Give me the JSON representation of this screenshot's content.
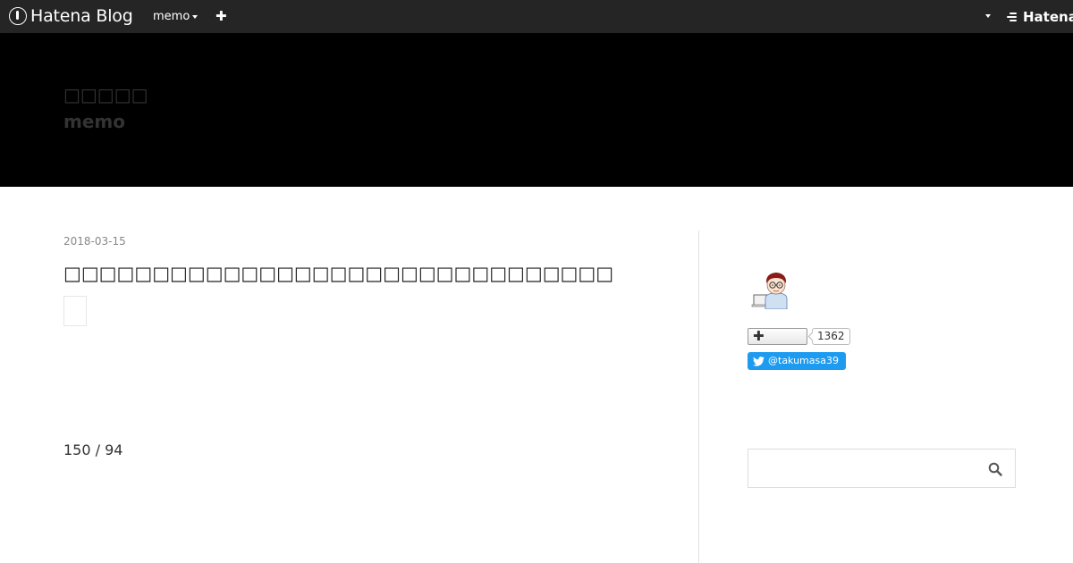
{
  "globalbar": {
    "logo_text": "Hatena Blog",
    "blog_menu_label": "memo",
    "add_label": "✚",
    "hatena_label": "Hatena"
  },
  "header": {
    "title_line1": "□□□□□",
    "title_line2": "memo"
  },
  "entry": {
    "date": "2018-03-15",
    "title": "□□□□□□□□□□□□□□□□□□□□□□□□□□□□□□□",
    "counter": "150 / 94"
  },
  "sidebar": {
    "subscribe_plus": "✚",
    "subscribe_count": "1362",
    "twitter_handle": "@takumasa39",
    "search_placeholder": ""
  },
  "colors": {
    "globalbar": "#252525",
    "header": "#000000",
    "twitter": "#1d9bf0"
  }
}
